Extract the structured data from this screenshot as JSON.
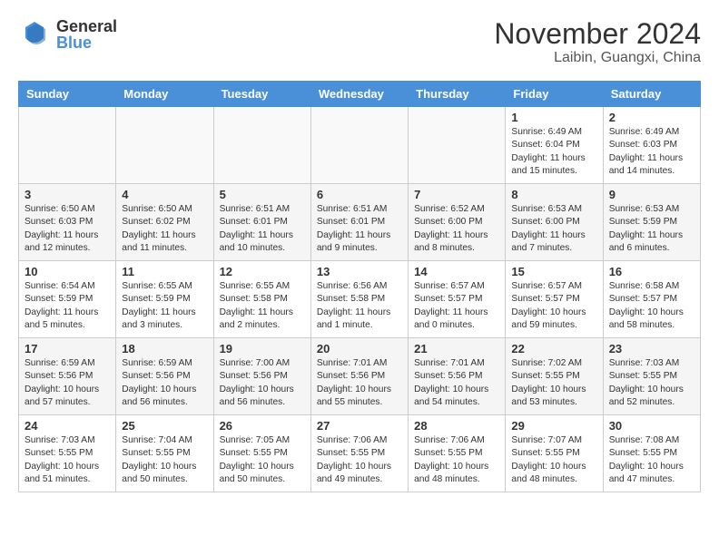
{
  "logo": {
    "general": "General",
    "blue": "Blue"
  },
  "header": {
    "month": "November 2024",
    "location": "Laibin, Guangxi, China"
  },
  "weekdays": [
    "Sunday",
    "Monday",
    "Tuesday",
    "Wednesday",
    "Thursday",
    "Friday",
    "Saturday"
  ],
  "weeks": [
    {
      "shaded": false,
      "days": [
        {
          "date": "",
          "info": ""
        },
        {
          "date": "",
          "info": ""
        },
        {
          "date": "",
          "info": ""
        },
        {
          "date": "",
          "info": ""
        },
        {
          "date": "",
          "info": ""
        },
        {
          "date": "1",
          "info": "Sunrise: 6:49 AM\nSunset: 6:04 PM\nDaylight: 11 hours\nand 15 minutes."
        },
        {
          "date": "2",
          "info": "Sunrise: 6:49 AM\nSunset: 6:03 PM\nDaylight: 11 hours\nand 14 minutes."
        }
      ]
    },
    {
      "shaded": true,
      "days": [
        {
          "date": "3",
          "info": "Sunrise: 6:50 AM\nSunset: 6:03 PM\nDaylight: 11 hours\nand 12 minutes."
        },
        {
          "date": "4",
          "info": "Sunrise: 6:50 AM\nSunset: 6:02 PM\nDaylight: 11 hours\nand 11 minutes."
        },
        {
          "date": "5",
          "info": "Sunrise: 6:51 AM\nSunset: 6:01 PM\nDaylight: 11 hours\nand 10 minutes."
        },
        {
          "date": "6",
          "info": "Sunrise: 6:51 AM\nSunset: 6:01 PM\nDaylight: 11 hours\nand 9 minutes."
        },
        {
          "date": "7",
          "info": "Sunrise: 6:52 AM\nSunset: 6:00 PM\nDaylight: 11 hours\nand 8 minutes."
        },
        {
          "date": "8",
          "info": "Sunrise: 6:53 AM\nSunset: 6:00 PM\nDaylight: 11 hours\nand 7 minutes."
        },
        {
          "date": "9",
          "info": "Sunrise: 6:53 AM\nSunset: 5:59 PM\nDaylight: 11 hours\nand 6 minutes."
        }
      ]
    },
    {
      "shaded": false,
      "days": [
        {
          "date": "10",
          "info": "Sunrise: 6:54 AM\nSunset: 5:59 PM\nDaylight: 11 hours\nand 5 minutes."
        },
        {
          "date": "11",
          "info": "Sunrise: 6:55 AM\nSunset: 5:59 PM\nDaylight: 11 hours\nand 3 minutes."
        },
        {
          "date": "12",
          "info": "Sunrise: 6:55 AM\nSunset: 5:58 PM\nDaylight: 11 hours\nand 2 minutes."
        },
        {
          "date": "13",
          "info": "Sunrise: 6:56 AM\nSunset: 5:58 PM\nDaylight: 11 hours\nand 1 minute."
        },
        {
          "date": "14",
          "info": "Sunrise: 6:57 AM\nSunset: 5:57 PM\nDaylight: 11 hours\nand 0 minutes."
        },
        {
          "date": "15",
          "info": "Sunrise: 6:57 AM\nSunset: 5:57 PM\nDaylight: 10 hours\nand 59 minutes."
        },
        {
          "date": "16",
          "info": "Sunrise: 6:58 AM\nSunset: 5:57 PM\nDaylight: 10 hours\nand 58 minutes."
        }
      ]
    },
    {
      "shaded": true,
      "days": [
        {
          "date": "17",
          "info": "Sunrise: 6:59 AM\nSunset: 5:56 PM\nDaylight: 10 hours\nand 57 minutes."
        },
        {
          "date": "18",
          "info": "Sunrise: 6:59 AM\nSunset: 5:56 PM\nDaylight: 10 hours\nand 56 minutes."
        },
        {
          "date": "19",
          "info": "Sunrise: 7:00 AM\nSunset: 5:56 PM\nDaylight: 10 hours\nand 56 minutes."
        },
        {
          "date": "20",
          "info": "Sunrise: 7:01 AM\nSunset: 5:56 PM\nDaylight: 10 hours\nand 55 minutes."
        },
        {
          "date": "21",
          "info": "Sunrise: 7:01 AM\nSunset: 5:56 PM\nDaylight: 10 hours\nand 54 minutes."
        },
        {
          "date": "22",
          "info": "Sunrise: 7:02 AM\nSunset: 5:55 PM\nDaylight: 10 hours\nand 53 minutes."
        },
        {
          "date": "23",
          "info": "Sunrise: 7:03 AM\nSunset: 5:55 PM\nDaylight: 10 hours\nand 52 minutes."
        }
      ]
    },
    {
      "shaded": false,
      "days": [
        {
          "date": "24",
          "info": "Sunrise: 7:03 AM\nSunset: 5:55 PM\nDaylight: 10 hours\nand 51 minutes."
        },
        {
          "date": "25",
          "info": "Sunrise: 7:04 AM\nSunset: 5:55 PM\nDaylight: 10 hours\nand 50 minutes."
        },
        {
          "date": "26",
          "info": "Sunrise: 7:05 AM\nSunset: 5:55 PM\nDaylight: 10 hours\nand 50 minutes."
        },
        {
          "date": "27",
          "info": "Sunrise: 7:06 AM\nSunset: 5:55 PM\nDaylight: 10 hours\nand 49 minutes."
        },
        {
          "date": "28",
          "info": "Sunrise: 7:06 AM\nSunset: 5:55 PM\nDaylight: 10 hours\nand 48 minutes."
        },
        {
          "date": "29",
          "info": "Sunrise: 7:07 AM\nSunset: 5:55 PM\nDaylight: 10 hours\nand 48 minutes."
        },
        {
          "date": "30",
          "info": "Sunrise: 7:08 AM\nSunset: 5:55 PM\nDaylight: 10 hours\nand 47 minutes."
        }
      ]
    }
  ]
}
